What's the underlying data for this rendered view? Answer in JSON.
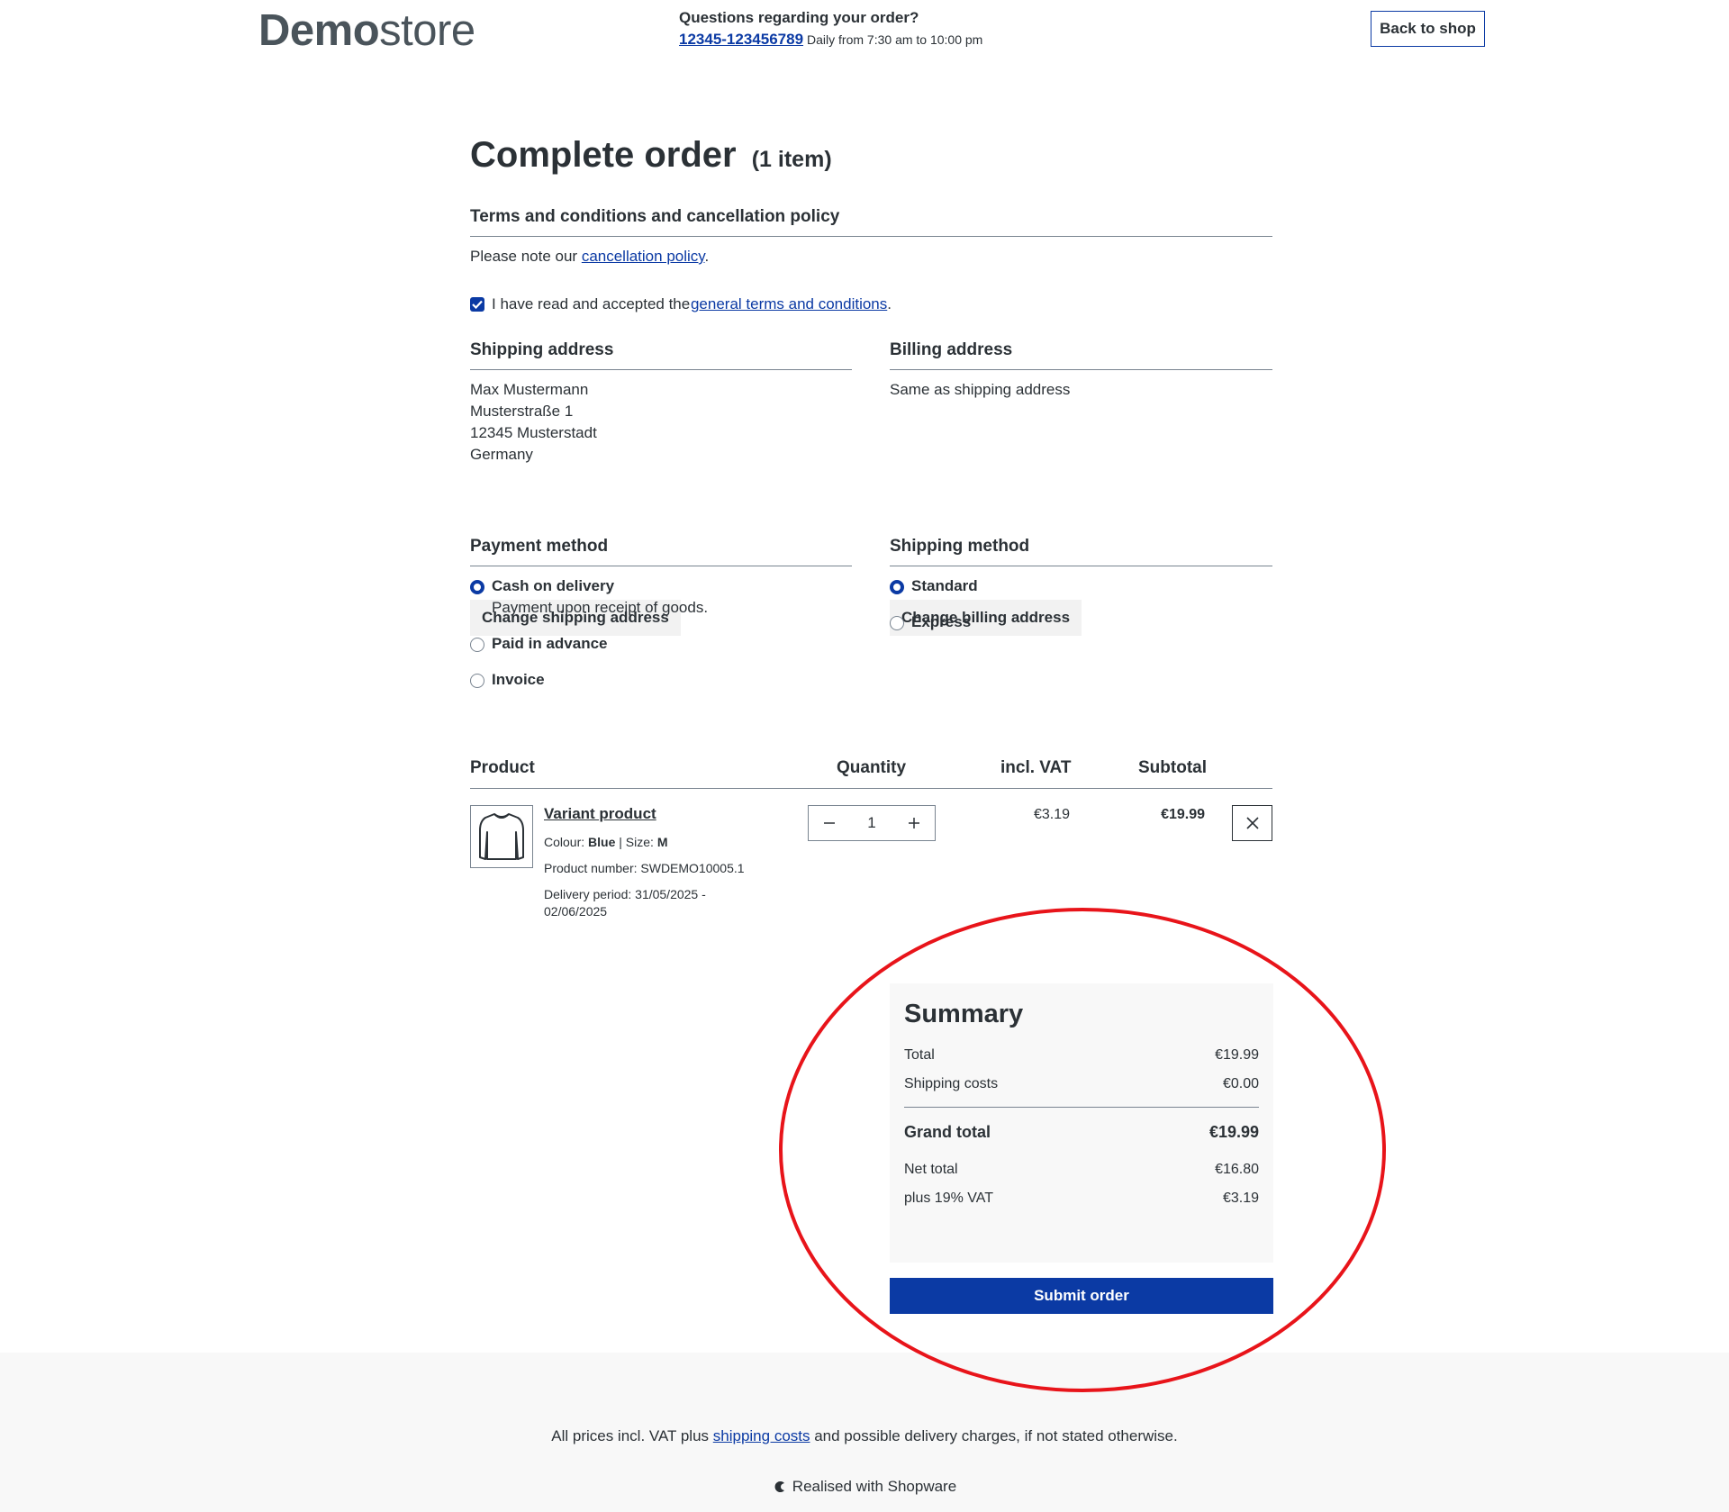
{
  "header": {
    "logo_bold": "Demo",
    "logo_light": "store",
    "contact_question": "Questions regarding your order?",
    "contact_phone": "12345-123456789",
    "contact_hours": "Daily from 7:30 am to 10:00 pm",
    "back_label": "Back to shop"
  },
  "page": {
    "title": "Complete order",
    "item_count": "(1 item)"
  },
  "terms": {
    "title": "Terms and conditions and cancellation policy",
    "note_prefix": "Please note our ",
    "note_link": "cancellation policy",
    "note_suffix": ".",
    "checkbox_prefix": "I have read and accepted the ",
    "checkbox_link": "general terms and conditions",
    "checkbox_suffix": ".",
    "checked": true
  },
  "shipping_address": {
    "title": "Shipping address",
    "lines": [
      "Max Mustermann",
      "Musterstraße 1",
      "12345 Musterstadt",
      "Germany"
    ],
    "change_label": "Change shipping address"
  },
  "billing_address": {
    "title": "Billing address",
    "text": "Same as shipping address",
    "change_label": "Change billing address"
  },
  "payment": {
    "title": "Payment method",
    "options": [
      {
        "label": "Cash on delivery",
        "description": "Payment upon receipt of goods.",
        "selected": true
      },
      {
        "label": "Paid in advance",
        "selected": false
      },
      {
        "label": "Invoice",
        "selected": false
      }
    ]
  },
  "shipping_method": {
    "title": "Shipping method",
    "options": [
      {
        "label": "Standard",
        "selected": true
      },
      {
        "label": "Express",
        "selected": false
      }
    ]
  },
  "cart": {
    "headers": {
      "product": "Product",
      "quantity": "Quantity",
      "incl_vat": "incl. VAT",
      "subtotal": "Subtotal"
    },
    "items": [
      {
        "name": "Variant product",
        "colour_label": "Colour:",
        "colour": "Blue",
        "size_label": "Size:",
        "size": "M",
        "product_number": "Product number: SWDEMO10005.1",
        "delivery_line1": "Delivery period: 31/05/2025 -",
        "delivery_line2": "02/06/2025",
        "quantity": "1",
        "vat": "€3.19",
        "subtotal": "€19.99",
        "icon": "shirt-icon"
      }
    ]
  },
  "summary": {
    "title": "Summary",
    "total_label": "Total",
    "total": "€19.99",
    "shipping_label": "Shipping costs",
    "shipping": "€0.00",
    "grand_label": "Grand total",
    "grand": "€19.99",
    "net_label": "Net total",
    "net": "€16.80",
    "vat_label": "plus 19% VAT",
    "vat": "€3.19",
    "submit_label": "Submit order"
  },
  "footer": {
    "note_prefix": "All prices incl. VAT plus ",
    "note_link": "shipping costs",
    "note_suffix": " and possible delivery charges, if not stated otherwise.",
    "brand": "Realised with Shopware"
  },
  "colors": {
    "accent": "#0b3aa4",
    "annotation": "#e8141a",
    "panel_bg": "#f8f8f8"
  }
}
